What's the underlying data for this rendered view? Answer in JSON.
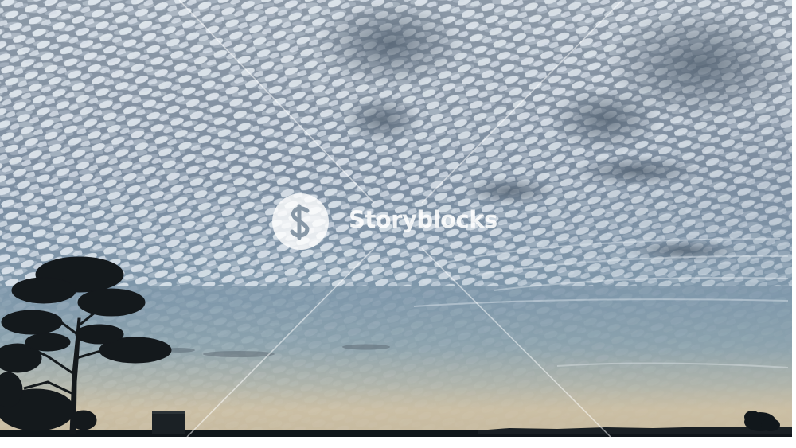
{
  "photo": {
    "description_colors": {
      "sky_top": "#8c99a7",
      "sky_horizon": "#c2b9a3",
      "cloud_light": "#e6ecf2",
      "cloud_dark": "#5f6f7f",
      "silhouette": "#10161a"
    },
    "icons": [
      "storyblocks-logo-icon",
      "tree-silhouette",
      "building-silhouette"
    ]
  },
  "watermark": {
    "brand": "Storyblocks",
    "color": "#ffffff"
  }
}
